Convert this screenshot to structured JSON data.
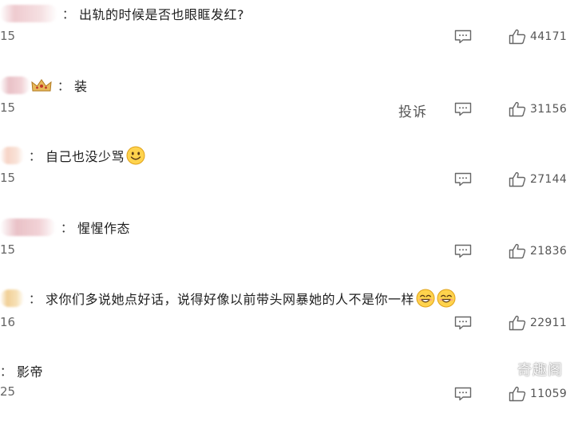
{
  "comments": [
    {
      "text": "出轨的时候是否也眼眶发红?",
      "time": "15",
      "likes": "44171"
    },
    {
      "text": "装",
      "time": "15",
      "likes": "31156",
      "complain": "投诉"
    },
    {
      "text": "自己也没少骂",
      "time": "15",
      "likes": "27144"
    },
    {
      "text": "惺惺作态",
      "time": "15",
      "likes": "21836"
    },
    {
      "text": "求你们多说她点好话，说得好像以前带头网暴她的人不是你一样",
      "time": "16",
      "likes": "22911"
    },
    {
      "text": "影帝",
      "time": "25",
      "likes": "11059"
    }
  ],
  "colon": "：",
  "watermark": "奇趣阁",
  "icons": {
    "reply": "comment-reply-icon",
    "like": "thumbs-up-icon",
    "emoji": "smile-emoji-icon",
    "crown": "crown-badge-icon"
  }
}
